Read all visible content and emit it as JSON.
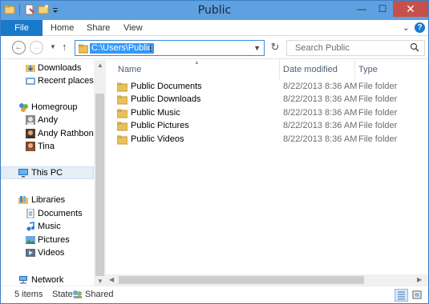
{
  "window": {
    "title": "Public"
  },
  "ribbon": {
    "tabs": {
      "file": "File",
      "home": "Home",
      "share": "Share",
      "view": "View"
    },
    "help_label": "?"
  },
  "controls": {
    "minimize": "—",
    "maximize": "☐",
    "close": "✕",
    "expand_ribbon": "⌄"
  },
  "address": {
    "path": "C:\\Users\\Public",
    "search_placeholder": "Search Public"
  },
  "nav_pane": {
    "items": [
      {
        "label": "Downloads",
        "icon": "downloads-folder-icon"
      },
      {
        "label": "Recent places",
        "icon": "recent-places-icon"
      },
      {
        "label": "Homegroup",
        "icon": "homegroup-icon"
      },
      {
        "label": "Andy",
        "icon": "user-avatar-icon"
      },
      {
        "label": "Andy Rathbone",
        "icon": "user-avatar-icon"
      },
      {
        "label": "Tina",
        "icon": "user-avatar-icon"
      },
      {
        "label": "This PC",
        "icon": "computer-icon"
      },
      {
        "label": "Libraries",
        "icon": "libraries-icon"
      },
      {
        "label": "Documents",
        "icon": "documents-library-icon"
      },
      {
        "label": "Music",
        "icon": "music-library-icon"
      },
      {
        "label": "Pictures",
        "icon": "pictures-library-icon"
      },
      {
        "label": "Videos",
        "icon": "videos-library-icon"
      },
      {
        "label": "Network",
        "icon": "network-icon"
      }
    ]
  },
  "file_list": {
    "columns": {
      "name": "Name",
      "date": "Date modified",
      "type": "Type"
    },
    "rows": [
      {
        "name": "Public Documents",
        "date": "8/22/2013 8:36 AM",
        "type": "File folder"
      },
      {
        "name": "Public Downloads",
        "date": "8/22/2013 8:36 AM",
        "type": "File folder"
      },
      {
        "name": "Public Music",
        "date": "8/22/2013 8:36 AM",
        "type": "File folder"
      },
      {
        "name": "Public Pictures",
        "date": "8/22/2013 8:36 AM",
        "type": "File folder"
      },
      {
        "name": "Public Videos",
        "date": "8/22/2013 8:36 AM",
        "type": "File folder"
      }
    ]
  },
  "status_bar": {
    "item_count": "5 items",
    "state_label": "State:",
    "state_value": "Shared"
  },
  "colors": {
    "titlebar": "#5fa0e0",
    "file_tab": "#1979ca",
    "close_button": "#c7504a",
    "folder": "#e8c15a",
    "selection": "#3399ff"
  }
}
